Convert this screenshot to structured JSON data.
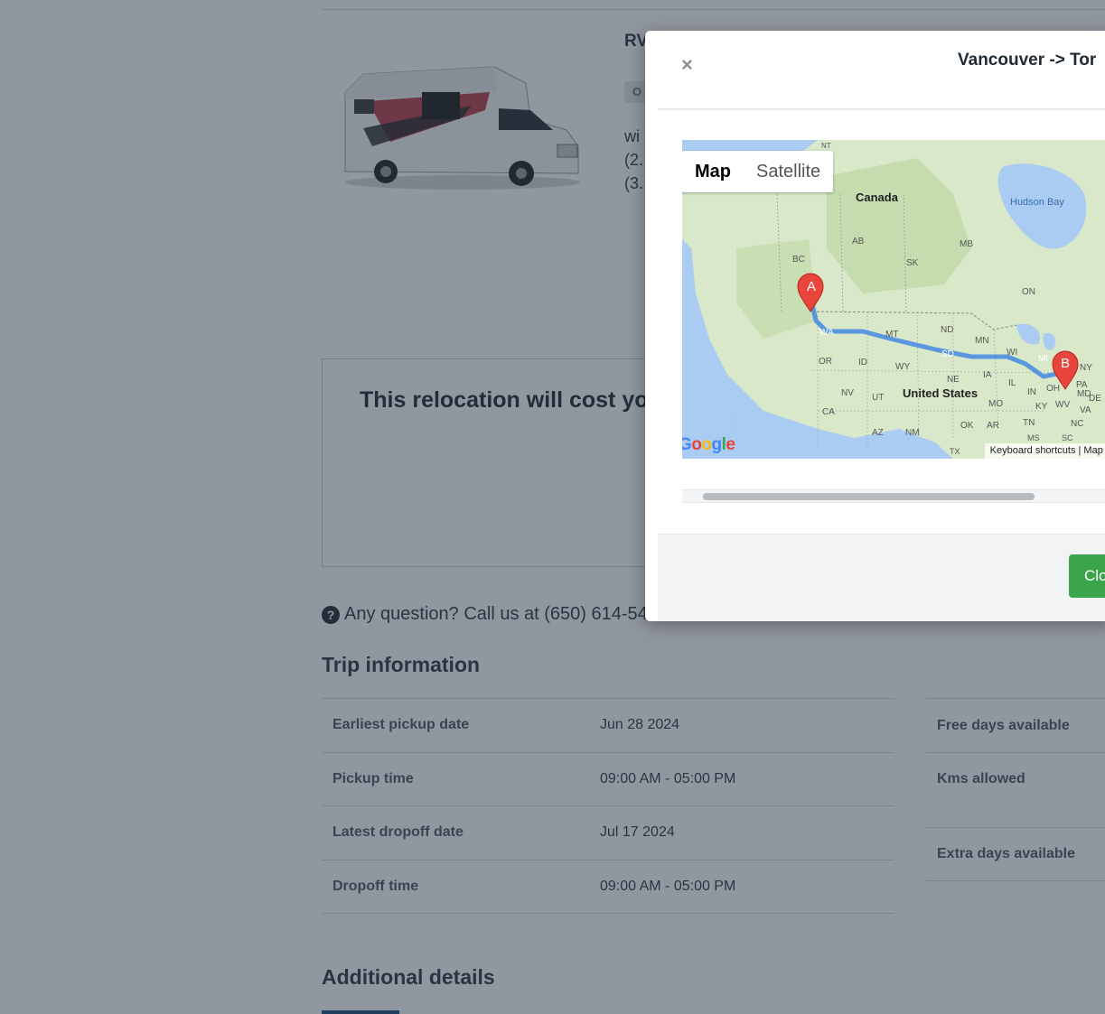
{
  "listing": {
    "title_fragment": "RV",
    "badge_fragment": "O",
    "detail_lines": [
      "wi",
      "(2.",
      "(3."
    ]
  },
  "cost": {
    "text": "This relocation will cost you"
  },
  "contact": {
    "icon": "question-circle-icon",
    "text": "Any question? Call us at (650) 614-54"
  },
  "trip": {
    "heading": "Trip information",
    "rows": [
      {
        "label": "Earliest pickup date",
        "value": "Jun 28 2024"
      },
      {
        "label": "Pickup time",
        "value": "09:00 AM - 05:00 PM"
      },
      {
        "label": "Latest dropoff date",
        "value": "Jul 17 2024"
      },
      {
        "label": "Dropoff time",
        "value": "09:00 AM - 05:00 PM"
      }
    ],
    "right_rows": [
      {
        "label": "Free days available"
      },
      {
        "label": "Kms allowed"
      },
      {
        "label": "Extra days available"
      }
    ]
  },
  "additional": {
    "heading": "Additional details"
  },
  "modal": {
    "close_symbol": "×",
    "title": "Vancouver -> Tor",
    "map": {
      "tab_map": "Map",
      "tab_satellite": "Satellite",
      "marker_a": "A",
      "marker_b": "B",
      "labels": {
        "canada": "Canada",
        "hudson_bay": "Hudson Bay",
        "united_states": "United States",
        "bc": "BC",
        "ab": "AB",
        "sk": "SK",
        "mb": "MB",
        "on": "ON",
        "wa": "WA",
        "mt": "MT",
        "nd": "ND",
        "mn": "MN",
        "or": "OR",
        "id": "ID",
        "wy": "WY",
        "sd": "SD",
        "wi": "WI",
        "mi": "MI",
        "ny": "NY",
        "ne": "NE",
        "ia": "IA",
        "pa": "PA",
        "nv": "NV",
        "ut": "UT",
        "il": "IL",
        "in": "IN",
        "oh": "OH",
        "md": "MD",
        "de": "DE",
        "ca": "CA",
        "mo": "MO",
        "ky": "KY",
        "wv": "WV",
        "va": "VA",
        "ok": "OK",
        "ar": "AR",
        "tn": "TN",
        "nc": "NC",
        "az": "AZ",
        "nm": "NM",
        "ms": "MS",
        "sc": "SC",
        "tx": "TX",
        "nt": "NT"
      },
      "google": "Google",
      "footer": "Keyboard shortcuts  |  Map d"
    },
    "close_button": "Clo"
  }
}
